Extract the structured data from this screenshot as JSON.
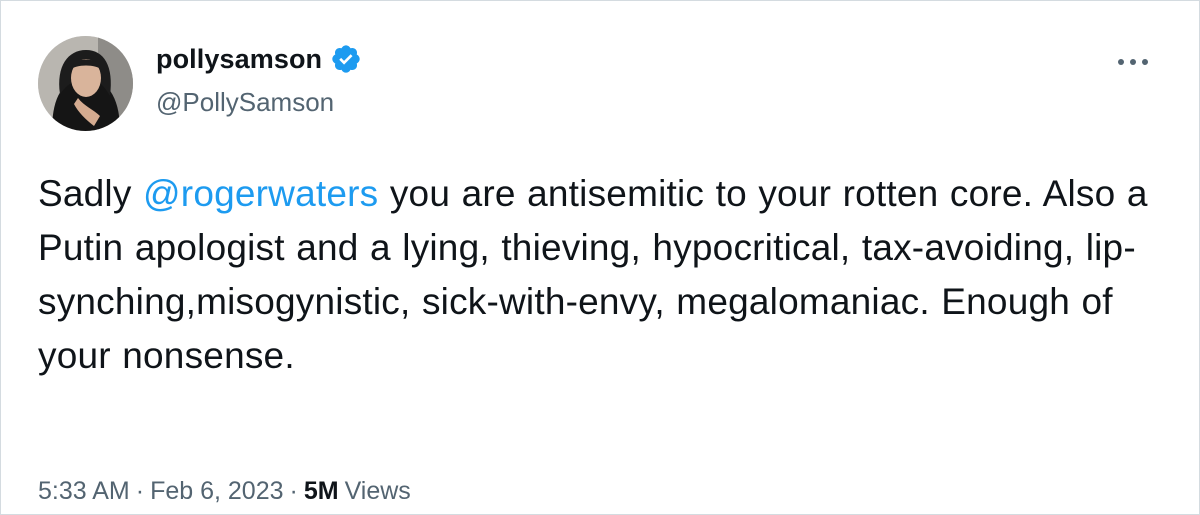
{
  "author": {
    "display_name": "pollysamson",
    "handle": "@PollySamson",
    "verified_icon": "verified-badge-icon",
    "verified_color": "#1d9bf0"
  },
  "menu": {
    "icon": "more-options-icon"
  },
  "tweet": {
    "text_before": "Sadly ",
    "mention": "@rogerwaters",
    "text_after": " you are antisemitic to your rotten core. Also a Putin apologist and a lying, thieving, hypocritical, tax-avoiding, lip-synching,misogynistic, sick-with-envy, megalomaniac. Enough of your nonsense.",
    "mention_color": "#1d9bf0"
  },
  "meta": {
    "time": "5:33 AM",
    "separator": "·",
    "date": "Feb 6, 2023",
    "views_count": "5M",
    "views_label": "Views"
  }
}
